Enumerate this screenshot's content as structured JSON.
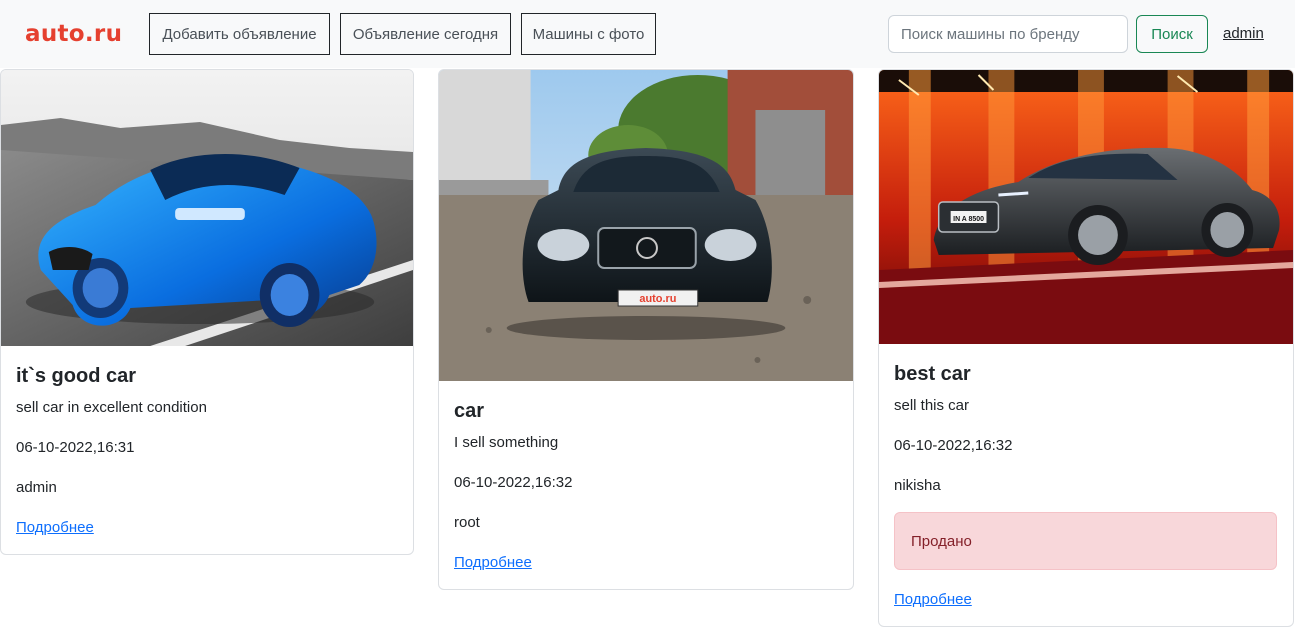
{
  "navbar": {
    "logo": "auto.ru",
    "buttons": [
      "Добавить объявление",
      "Объявление сегодня",
      "Машины с фото"
    ],
    "search": {
      "placeholder": "Поиск машины по бренду",
      "value": ""
    },
    "search_button": "Поиск",
    "user": "admin"
  },
  "cards": [
    {
      "image": "blue-sports-car-photo",
      "title": "it`s good car",
      "description": "sell car in excellent condition",
      "date": "06-10-2022,16:31",
      "user": "admin",
      "link": "Подробнее"
    },
    {
      "image": "black-sedan-lexus-photo",
      "title": "car",
      "description": "I sell something",
      "date": "06-10-2022,16:32",
      "user": "root",
      "link": "Подробнее",
      "plate_text": "auto.ru"
    },
    {
      "image": "dark-grey-audi-showroom-photo",
      "title": "best car",
      "description": "sell this car",
      "date": "06-10-2022,16:32",
      "user": "nikisha",
      "status": "Продано",
      "link": "Подробнее",
      "plate_text": "IN A 8500"
    }
  ],
  "colors": {
    "brand": "#e5402f",
    "success": "#198754",
    "link": "#0d6efd",
    "alert_bg": "#f8d7da",
    "alert_text": "#842029"
  }
}
